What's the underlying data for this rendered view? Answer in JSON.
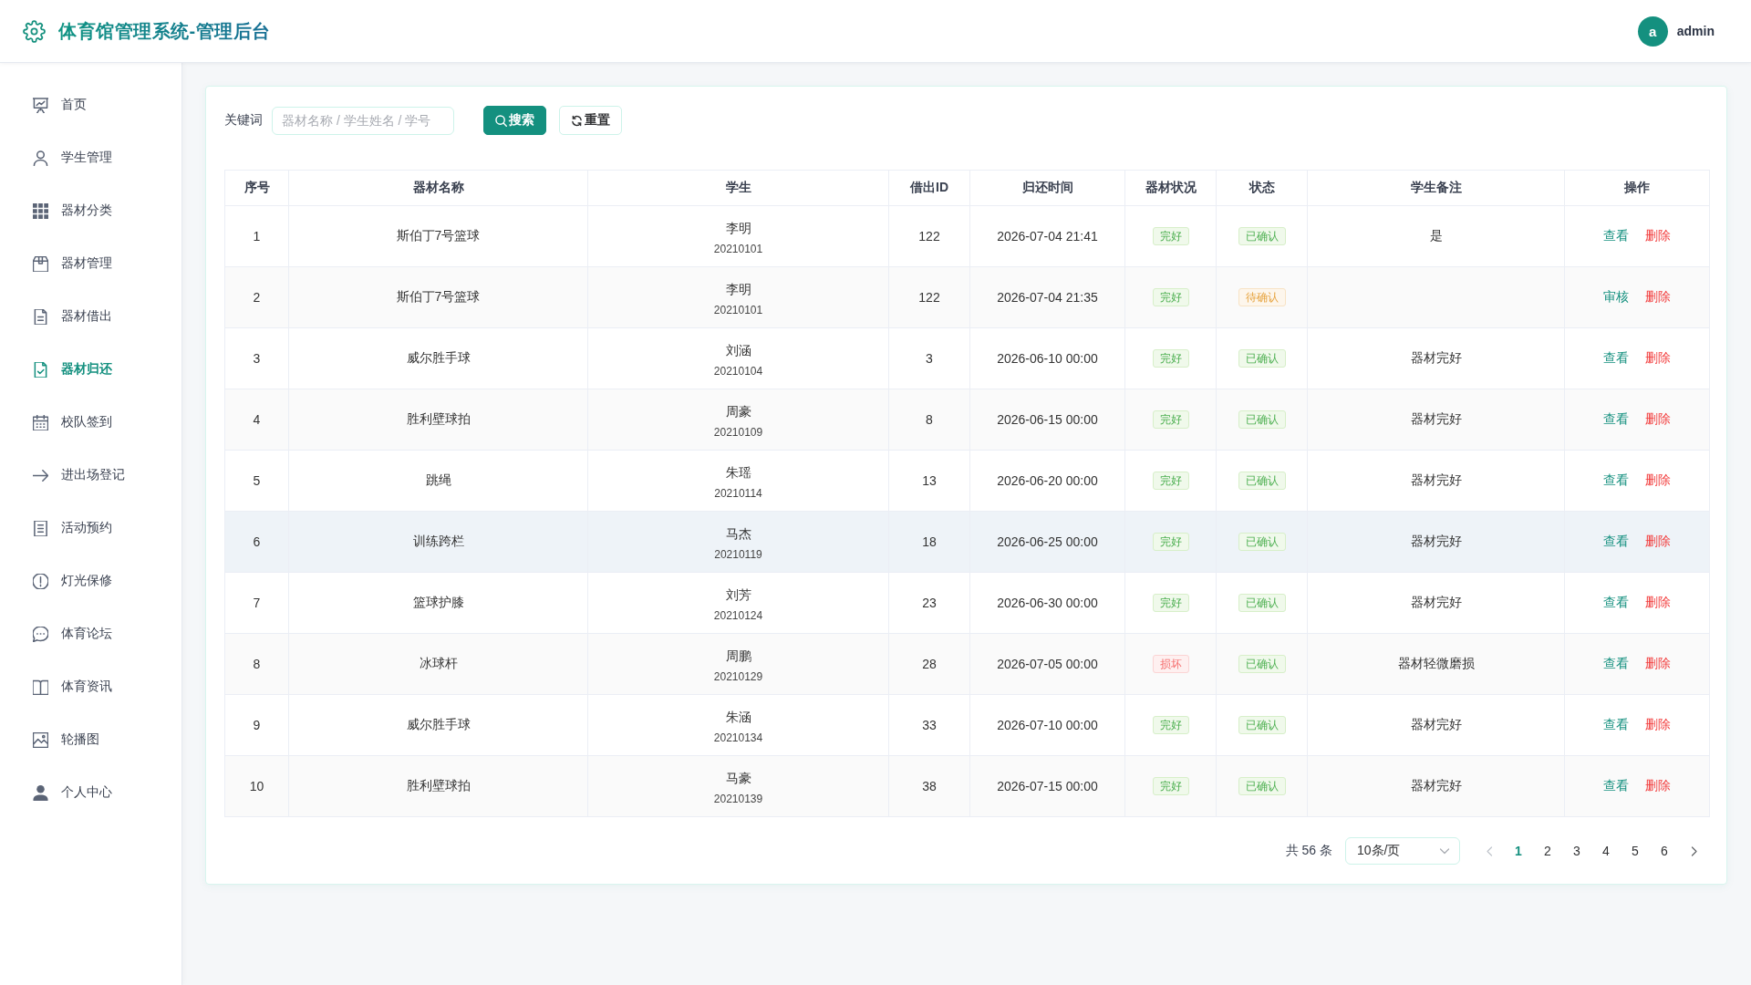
{
  "header": {
    "title": "体育馆管理系统-管理后台",
    "user": {
      "initial": "a",
      "name": "admin"
    }
  },
  "sidebar": {
    "items": [
      {
        "label": "首页",
        "selected": false
      },
      {
        "label": "学生管理",
        "selected": false
      },
      {
        "label": "器材分类",
        "selected": false
      },
      {
        "label": "器材管理",
        "selected": false
      },
      {
        "label": "器材借出",
        "selected": false
      },
      {
        "label": "器材归还",
        "selected": true
      },
      {
        "label": "校队签到",
        "selected": false
      },
      {
        "label": "进出场登记",
        "selected": false
      },
      {
        "label": "活动预约",
        "selected": false
      },
      {
        "label": "灯光保修",
        "selected": false
      },
      {
        "label": "体育论坛",
        "selected": false
      },
      {
        "label": "体育资讯",
        "selected": false
      },
      {
        "label": "轮播图",
        "selected": false
      },
      {
        "label": "个人中心",
        "selected": false
      }
    ]
  },
  "search": {
    "label": "关键词",
    "placeholder": "器材名称 / 学生姓名 / 学号",
    "buttons": [
      {
        "label": "搜索",
        "kind": "primary"
      },
      {
        "label": "重置",
        "kind": "default"
      }
    ]
  },
  "table": {
    "columns": [
      "序号",
      "器材名称",
      "学生",
      "借出ID",
      "归还时间",
      "器材状况",
      "状态",
      "学生备注",
      "操作"
    ],
    "rows": [
      {
        "no": "1",
        "equipment": "斯伯丁7号篮球",
        "student": "李明",
        "student_no": "20210101",
        "borrow_id": "122",
        "return_time": "2026-07-04 21:41",
        "condition": {
          "text": "完好",
          "kind": "success"
        },
        "status": {
          "text": "已确认",
          "kind": "success"
        },
        "note": "是",
        "actions": [
          {
            "label": "查看",
            "kind": "primary"
          },
          {
            "label": "删除",
            "kind": "danger"
          }
        ],
        "highlighted": false
      },
      {
        "no": "2",
        "equipment": "斯伯丁7号篮球",
        "student": "李明",
        "student_no": "20210101",
        "borrow_id": "122",
        "return_time": "2026-07-04 21:35",
        "condition": {
          "text": "完好",
          "kind": "success"
        },
        "status": {
          "text": "待确认",
          "kind": "warning"
        },
        "actions": [
          {
            "label": "审核",
            "kind": "primary"
          },
          {
            "label": "删除",
            "kind": "danger"
          }
        ],
        "highlighted": false
      },
      {
        "no": "3",
        "equipment": "威尔胜手球",
        "student": "刘涵",
        "student_no": "20210104",
        "borrow_id": "3",
        "return_time": "2026-06-10 00:00",
        "condition": {
          "text": "完好",
          "kind": "success"
        },
        "status": {
          "text": "已确认",
          "kind": "success"
        },
        "note": "器材完好",
        "actions": [
          {
            "label": "查看",
            "kind": "primary"
          },
          {
            "label": "删除",
            "kind": "danger"
          }
        ],
        "highlighted": false
      },
      {
        "no": "4",
        "equipment": "胜利壁球拍",
        "student": "周豪",
        "student_no": "20210109",
        "borrow_id": "8",
        "return_time": "2026-06-15 00:00",
        "condition": {
          "text": "完好",
          "kind": "success"
        },
        "status": {
          "text": "已确认",
          "kind": "success"
        },
        "note": "器材完好",
        "actions": [
          {
            "label": "查看",
            "kind": "primary"
          },
          {
            "label": "删除",
            "kind": "danger"
          }
        ],
        "highlighted": false
      },
      {
        "no": "5",
        "equipment": "跳绳",
        "student": "朱瑶",
        "student_no": "20210114",
        "borrow_id": "13",
        "return_time": "2026-06-20 00:00",
        "condition": {
          "text": "完好",
          "kind": "success"
        },
        "status": {
          "text": "已确认",
          "kind": "success"
        },
        "note": "器材完好",
        "actions": [
          {
            "label": "查看",
            "kind": "primary"
          },
          {
            "label": "删除",
            "kind": "danger"
          }
        ],
        "highlighted": false
      },
      {
        "no": "6",
        "equipment": "训练跨栏",
        "student": "马杰",
        "student_no": "20210119",
        "borrow_id": "18",
        "return_time": "2026-06-25 00:00",
        "condition": {
          "text": "完好",
          "kind": "success"
        },
        "status": {
          "text": "已确认",
          "kind": "success"
        },
        "note": "器材完好",
        "actions": [
          {
            "label": "查看",
            "kind": "primary"
          },
          {
            "label": "删除",
            "kind": "danger"
          }
        ],
        "highlighted": true
      },
      {
        "no": "7",
        "equipment": "篮球护膝",
        "student": "刘芳",
        "student_no": "20210124",
        "borrow_id": "23",
        "return_time": "2026-06-30 00:00",
        "condition": {
          "text": "完好",
          "kind": "success"
        },
        "status": {
          "text": "已确认",
          "kind": "success"
        },
        "note": "器材完好",
        "actions": [
          {
            "label": "查看",
            "kind": "primary"
          },
          {
            "label": "删除",
            "kind": "danger"
          }
        ],
        "highlighted": false
      },
      {
        "no": "8",
        "equipment": "冰球杆",
        "student": "周鹏",
        "student_no": "20210129",
        "borrow_id": "28",
        "return_time": "2026-07-05 00:00",
        "condition": {
          "text": "损坏",
          "kind": "danger"
        },
        "status": {
          "text": "已确认",
          "kind": "success"
        },
        "note": "器材轻微磨损",
        "actions": [
          {
            "label": "查看",
            "kind": "primary"
          },
          {
            "label": "删除",
            "kind": "danger"
          }
        ],
        "highlighted": false
      },
      {
        "no": "9",
        "equipment": "威尔胜手球",
        "student": "朱涵",
        "student_no": "20210134",
        "borrow_id": "33",
        "return_time": "2026-07-10 00:00",
        "condition": {
          "text": "完好",
          "kind": "success"
        },
        "status": {
          "text": "已确认",
          "kind": "success"
        },
        "note": "器材完好",
        "actions": [
          {
            "label": "查看",
            "kind": "primary"
          },
          {
            "label": "删除",
            "kind": "danger"
          }
        ],
        "highlighted": false
      },
      {
        "no": "10",
        "equipment": "胜利壁球拍",
        "student": "马豪",
        "student_no": "20210139",
        "borrow_id": "38",
        "return_time": "2026-07-15 00:00",
        "condition": {
          "text": "完好",
          "kind": "success"
        },
        "status": {
          "text": "已确认",
          "kind": "success"
        },
        "note": "器材完好",
        "actions": [
          {
            "label": "查看",
            "kind": "primary"
          },
          {
            "label": "删除",
            "kind": "danger"
          }
        ],
        "highlighted": false
      }
    ]
  },
  "pagination": {
    "total": "共 56 条",
    "page_size": "10条/页",
    "prev": {
      "disabled": true
    },
    "next": {
      "disabled": false
    },
    "pages": [
      {
        "label": "1",
        "selected": true
      },
      {
        "label": "2",
        "selected": false
      },
      {
        "label": "3",
        "selected": false
      },
      {
        "label": "4",
        "selected": false
      },
      {
        "label": "5",
        "selected": false
      },
      {
        "label": "6",
        "selected": false
      }
    ]
  }
}
